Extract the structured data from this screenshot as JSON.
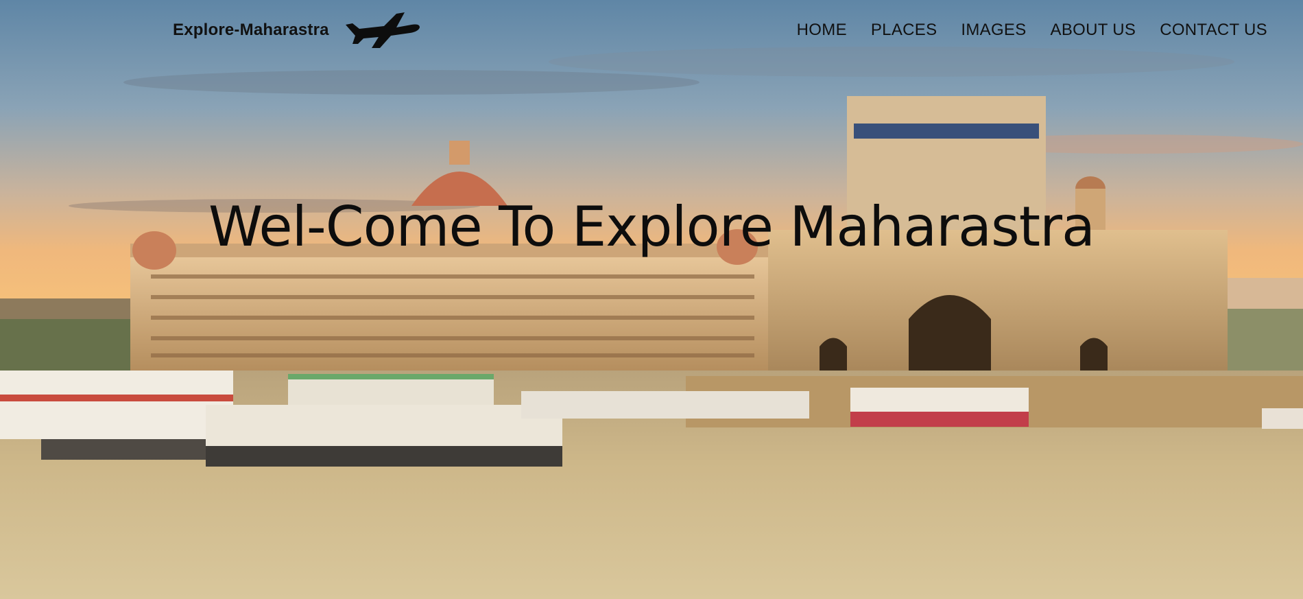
{
  "brand": {
    "name": "Explore-Maharastra",
    "logo_icon": "airplane-icon"
  },
  "nav": {
    "items": [
      {
        "label": "HOME"
      },
      {
        "label": "PLACES"
      },
      {
        "label": "IMAGES"
      },
      {
        "label": "ABOUT US"
      },
      {
        "label": "CONTACT US"
      }
    ]
  },
  "hero": {
    "headline": "Wel-Come To Explore Maharastra",
    "background_image": "Taj Mahal Palace Hotel and Gateway of India at sunset with ferry boats"
  },
  "colors": {
    "text": "#111111",
    "sky_top": "#5f86a6",
    "sunset": "#f2b36e",
    "water": "#cbb487",
    "building": "#d8b585"
  }
}
